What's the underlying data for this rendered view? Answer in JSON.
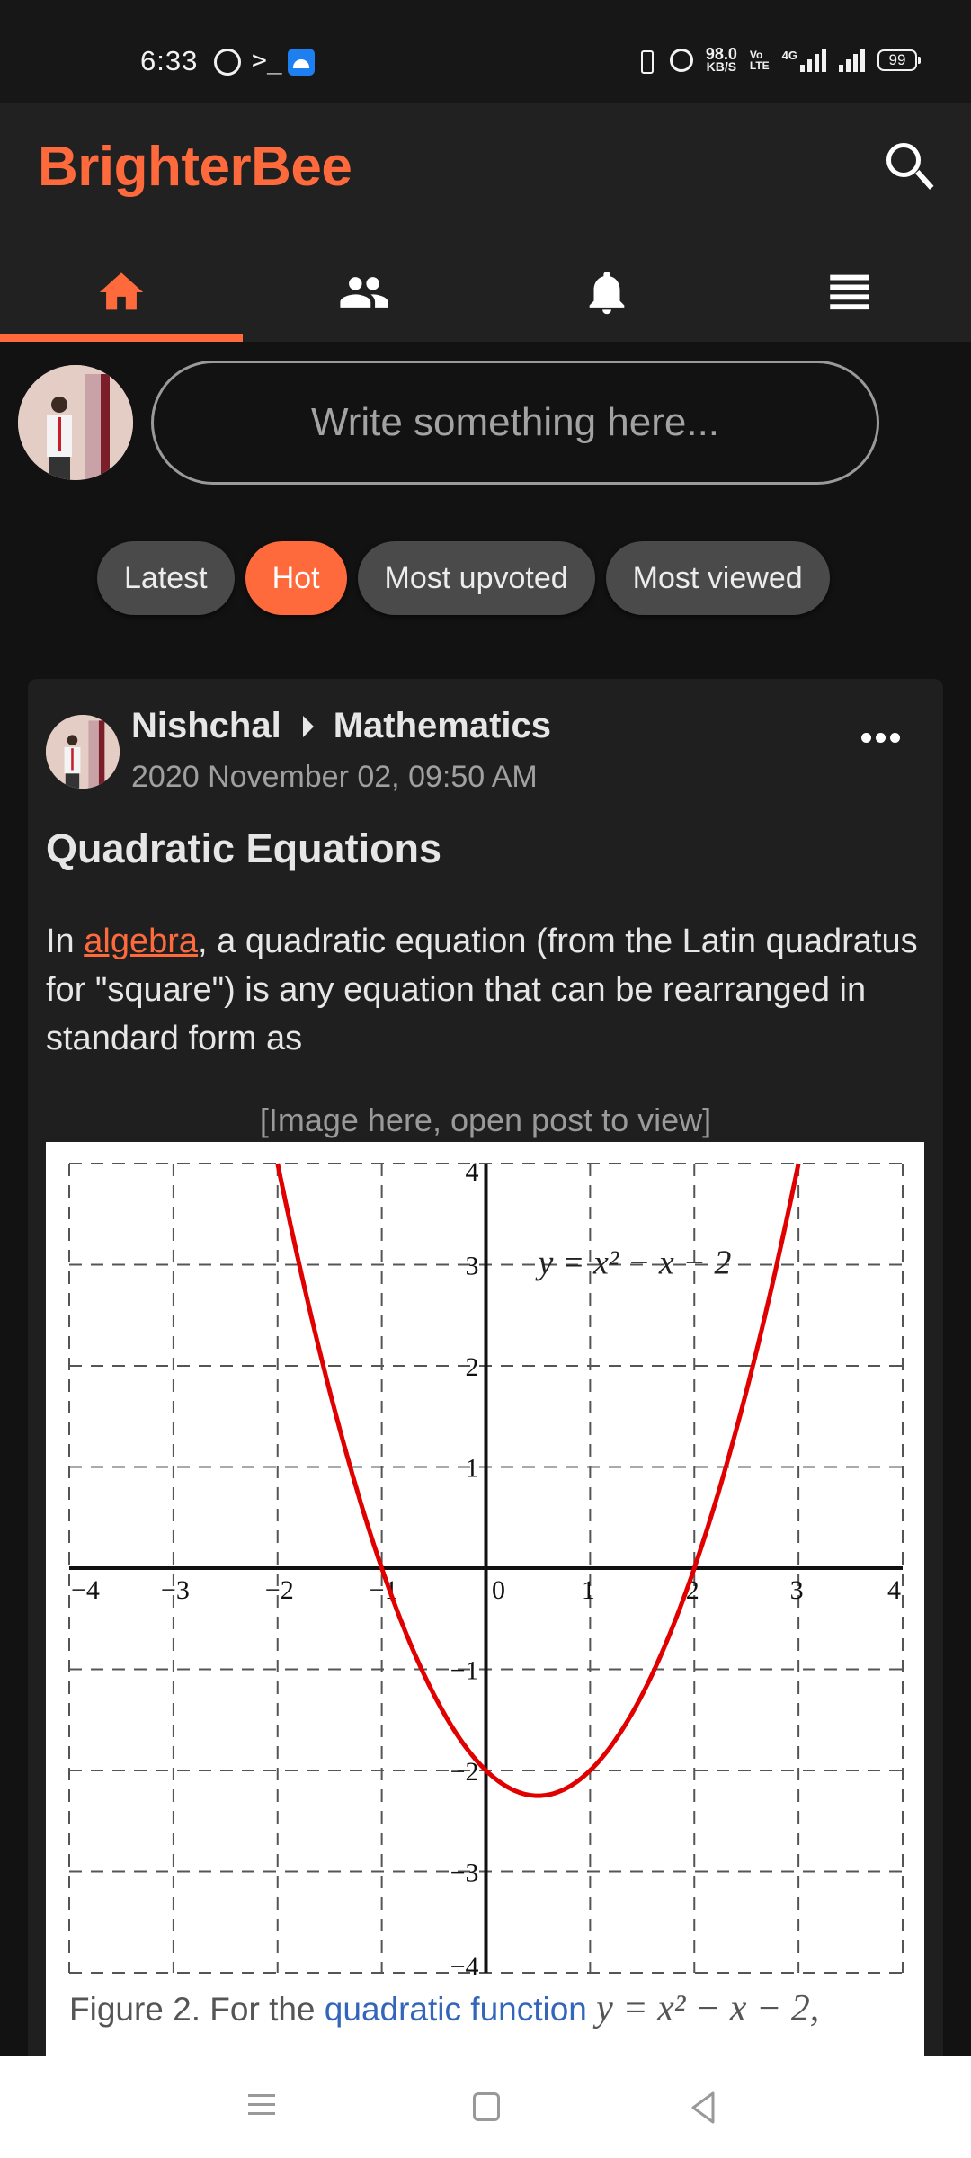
{
  "status_bar": {
    "time": "6:33",
    "left_icons": [
      "whatsapp-icon",
      "terminal-icon",
      "android-icon"
    ],
    "right_icons": [
      "vibrate-icon",
      "alarm-icon",
      "volte-icon",
      "signal-4g-icon",
      "signal-icon",
      "battery-icon"
    ],
    "network_speed_value": "98.0",
    "network_speed_unit": "KB/S",
    "volte_top": "Vo",
    "volte_bottom": "LTE",
    "network_type": "4G",
    "battery_level": "99"
  },
  "header": {
    "brand": "BrighterBee",
    "brand_color": "#ff6a3d",
    "search_icon": "search-icon"
  },
  "tabs": [
    {
      "name": "home",
      "icon": "home-icon",
      "active": true
    },
    {
      "name": "groups",
      "icon": "people-icon",
      "active": false
    },
    {
      "name": "notifications",
      "icon": "bell-icon",
      "active": false
    },
    {
      "name": "menu",
      "icon": "menu-icon",
      "active": false
    }
  ],
  "composer": {
    "placeholder": "Write something here..."
  },
  "filters": [
    {
      "label": "Latest",
      "active": false
    },
    {
      "label": "Hot",
      "active": true
    },
    {
      "label": "Most upvoted",
      "active": false
    },
    {
      "label": "Most viewed",
      "active": false
    }
  ],
  "post": {
    "author": "Nishchal",
    "community": "Mathematics",
    "date": "2020 November 02, 09:50 AM",
    "title": "Quadratic Equations",
    "body_prefix": "In ",
    "body_link": "algebra",
    "body_suffix": ", a quadratic equation (from the Latin quadratus for \"square\") is any equation that can be rearranged in standard form as",
    "image_placeholder": "[Image here, open post to view]",
    "figure_caption_prefix": "Figure 2. For the ",
    "figure_caption_link": "quadratic function",
    "figure_caption_math": "y = x² − x − 2,"
  },
  "chart_data": {
    "type": "line",
    "title": "",
    "annotation": "y = x² − x − 2",
    "function": "x^2 - x - 2",
    "series": [
      {
        "name": "y = x^2 - x - 2",
        "color": "#e00000",
        "x": [
          -2,
          -1.5,
          -1,
          -0.5,
          0,
          0.5,
          1,
          1.5,
          2,
          2.5,
          3
        ],
        "y": [
          4,
          1.75,
          0,
          -1.25,
          -2,
          -2.25,
          -2,
          -1.25,
          0,
          1.75,
          4
        ]
      }
    ],
    "xlim": [
      -4,
      4
    ],
    "ylim": [
      -4,
      4
    ],
    "x_ticks": [
      "−4",
      "−3",
      "−2",
      "−1",
      "0",
      "1",
      "2",
      "3",
      "4"
    ],
    "y_ticks": [
      "4",
      "3",
      "2",
      "1",
      "−1",
      "−2",
      "−3",
      "−4"
    ],
    "grid": true,
    "grid_style": "dashed",
    "xlabel": "",
    "ylabel": ""
  },
  "nav_bar": {
    "buttons": [
      "recents-icon",
      "home-icon",
      "back-icon"
    ]
  }
}
